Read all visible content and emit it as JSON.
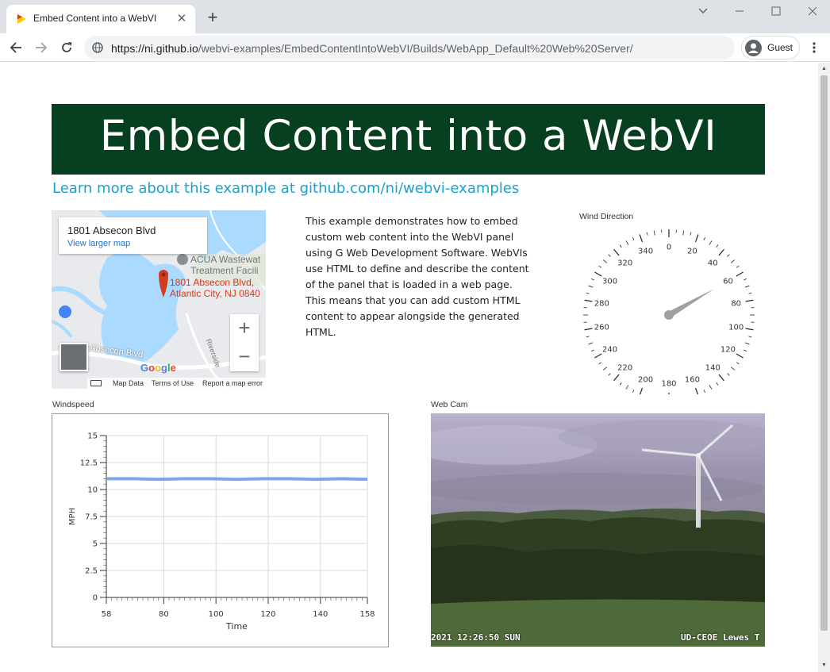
{
  "browser": {
    "tab_title": "Embed Content into a WebVI",
    "url_host": "https://ni.github.io",
    "url_path": "/webvi-examples/EmbedContentIntoWebVI/Builds/WebApp_Default%20Web%20Server/",
    "profile_name": "Guest",
    "tab_close_glyph": "✕",
    "new_tab_glyph": "+",
    "icons": [
      "back-icon",
      "forward-icon",
      "reload-icon",
      "site-info-icon",
      "profile-icon",
      "menu-icon",
      "minimize-icon",
      "maximize-icon",
      "close-icon",
      "tab-search-icon"
    ]
  },
  "page": {
    "title": "Embed Content into a WebVI",
    "learn_more": "Learn more about this example at github.com/ni/webvi-examples",
    "description": "This example demonstrates how to embed custom web content into the WebVI panel using G Web Development Software. WebVIs use HTML to define and describe the content of the panel that is loaded in a web page. This means that you can add custom HTML content to appear alongside the generated HTML.",
    "colors": {
      "banner": "#073f21",
      "link": "#1ba1d0",
      "series": "#7ea6e0",
      "needle": "#a0a0a0"
    }
  },
  "map": {
    "address": "1801 Absecon Blvd",
    "view_larger": "View larger map",
    "poi_line1": "ACUA Wastewat",
    "poi_line2": "Treatment Facili",
    "pin_line1": "1801 Absecon Blvd,",
    "pin_line2": "Atlantic City, NJ 0840",
    "road": "Absecon Blvd",
    "road2": "Riverside",
    "zoom_in": "+",
    "zoom_out": "−",
    "footer_data": "Map Data",
    "footer_terms": "Terms of Use",
    "footer_report": "Report a map error",
    "logo": [
      "G",
      "o",
      "o",
      "g",
      "l",
      "e"
    ],
    "logo_colors": [
      "#4285f4",
      "#ea4335",
      "#fbbc05",
      "#4285f4",
      "#34a853",
      "#ea4335"
    ]
  },
  "gauge": {
    "label": "Wind Direction",
    "min": 0,
    "max": 360,
    "major_step": 20,
    "labels": [
      "0",
      "20",
      "40",
      "60",
      "80",
      "100",
      "120",
      "140",
      "160",
      "180",
      "200",
      "220",
      "240",
      "260",
      "280",
      "300",
      "320",
      "340"
    ],
    "value": 60
  },
  "windspeed": {
    "label": "Windspeed",
    "chart_data": {
      "type": "line",
      "title": "",
      "xlabel": "Time",
      "ylabel": "MPH",
      "xlim": [
        58,
        158
      ],
      "ylim": [
        0,
        15
      ],
      "x_ticks": [
        "58",
        "80",
        "100",
        "120",
        "140",
        "158"
      ],
      "x_tick_values": [
        58,
        80,
        100,
        120,
        140,
        158
      ],
      "y_ticks": [
        "0",
        "2.5",
        "5",
        "7.5",
        "10",
        "12.5",
        "15"
      ],
      "y_tick_values": [
        0,
        2.5,
        5,
        7.5,
        10,
        12.5,
        15
      ],
      "grid": true,
      "series": [
        {
          "x": [
            58,
            68,
            78,
            88,
            98,
            108,
            118,
            128,
            138,
            148,
            158
          ],
          "values": [
            11.0,
            11.0,
            10.95,
            11.0,
            11.0,
            10.95,
            11.0,
            11.0,
            10.95,
            11.0,
            10.95
          ]
        }
      ]
    }
  },
  "webcam": {
    "label": "Web Cam",
    "stamp_left": "2021 12:26:50 SUN",
    "stamp_right": "UD-CEOE Lewes T"
  }
}
